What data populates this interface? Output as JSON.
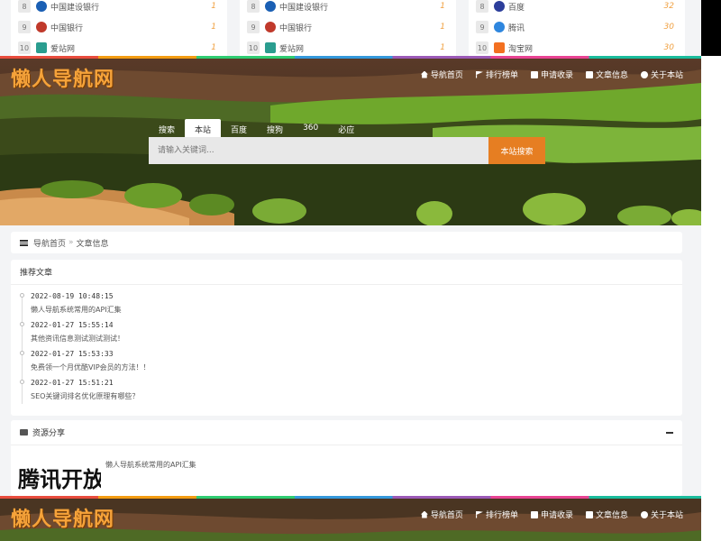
{
  "rank_columns": [
    {
      "rows": [
        {
          "num": "8",
          "name": "中国建设银行",
          "count": "1",
          "icon_color": "#1a5fb4"
        },
        {
          "num": "9",
          "name": "中国银行",
          "count": "1",
          "icon_color": "#c0392b"
        },
        {
          "num": "10",
          "name": "爱站网",
          "count": "1",
          "icon_color": "#2a9d8f"
        }
      ]
    },
    {
      "rows": [
        {
          "num": "8",
          "name": "中国建设银行",
          "count": "1",
          "icon_color": "#1a5fb4"
        },
        {
          "num": "9",
          "name": "中国银行",
          "count": "1",
          "icon_color": "#c0392b"
        },
        {
          "num": "10",
          "name": "爱站网",
          "count": "1",
          "icon_color": "#2a9d8f"
        }
      ]
    },
    {
      "rows": [
        {
          "num": "8",
          "name": "百度",
          "count": "32",
          "icon_color": "#2c3e9b"
        },
        {
          "num": "9",
          "name": "腾讯",
          "count": "30",
          "icon_color": "#2e86de"
        },
        {
          "num": "10",
          "name": "淘宝网",
          "count": "30",
          "icon_color": "#f37021"
        }
      ]
    }
  ],
  "site": {
    "logo": "懒人导航网",
    "nav": [
      "导航首页",
      "排行榜单",
      "申请收录",
      "文章信息",
      "关于本站"
    ]
  },
  "search": {
    "tabs": [
      "搜索",
      "本站",
      "百度",
      "搜狗",
      "360",
      "必应"
    ],
    "active_tab": "本站",
    "placeholder": "请输入关键词...",
    "button": "本站搜索"
  },
  "breadcrumb": {
    "home": "导航首页",
    "sep": "»",
    "current": "文章信息"
  },
  "articles": {
    "title": "推荐文章",
    "items": [
      {
        "time": "2022-08-19 10:48:15",
        "title": "懒人导航系统常用的API汇集"
      },
      {
        "time": "2022-01-27 15:55:14",
        "title": "其他资讯信息测试测试测试！"
      },
      {
        "time": "2022-01-27 15:53:33",
        "title": "免费领一个月优酷VIP会员的方法！！"
      },
      {
        "time": "2022-01-27 15:51:21",
        "title": "SEO关键词排名优化原理有哪些？"
      }
    ]
  },
  "share": {
    "title": "资源分享",
    "thumb_text": "腾讯开放",
    "link": "懒人导航系统常用的API汇集"
  },
  "colors": {
    "accent": "#e67e22",
    "logo": "#f6a33a",
    "count": "#f0a040"
  }
}
